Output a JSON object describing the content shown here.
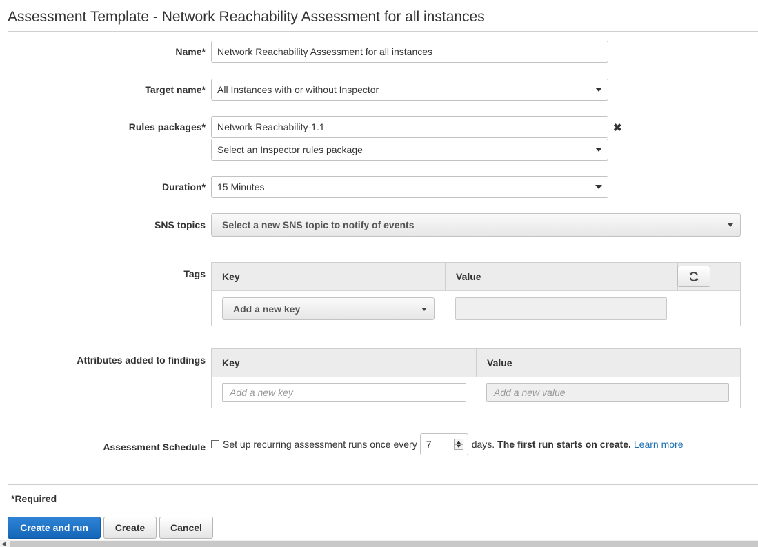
{
  "page": {
    "title": "Assessment Template - Network Reachability Assessment for all instances"
  },
  "form": {
    "name": {
      "label": "Name*",
      "value": "Network Reachability Assessment for all instances"
    },
    "target": {
      "label": "Target name*",
      "value": "All Instances with or without Inspector"
    },
    "rules": {
      "label": "Rules packages*",
      "selected": "Network Reachability-1.1",
      "remove_glyph": "✖",
      "select_placeholder": "Select an Inspector rules package"
    },
    "duration": {
      "label": "Duration*",
      "value": "15 Minutes"
    },
    "sns": {
      "label": "SNS topics",
      "placeholder": "Select a new SNS topic to notify of events"
    },
    "tags": {
      "label": "Tags",
      "key_header": "Key",
      "value_header": "Value",
      "key_select": "Add a new key"
    },
    "attributes": {
      "label": "Attributes added to findings",
      "key_header": "Key",
      "value_header": "Value",
      "key_placeholder": "Add a new key",
      "value_placeholder": "Add a new value"
    },
    "schedule": {
      "label": "Assessment Schedule",
      "checkbox_text": "Set up recurring assessment runs once every",
      "interval": "7",
      "days_text": "days.",
      "first_run_text": "The first run starts on create.",
      "learn_more": "Learn more",
      "checked": false
    }
  },
  "footer": {
    "required_note": "*Required",
    "create_and_run": "Create and run",
    "create": "Create",
    "cancel": "Cancel"
  },
  "colors": {
    "primary": "#1a6fc4",
    "link": "#1a6eb4"
  },
  "icons": {
    "refresh": "refresh-icon",
    "caret": "caret-down-icon",
    "remove": "remove-icon"
  }
}
